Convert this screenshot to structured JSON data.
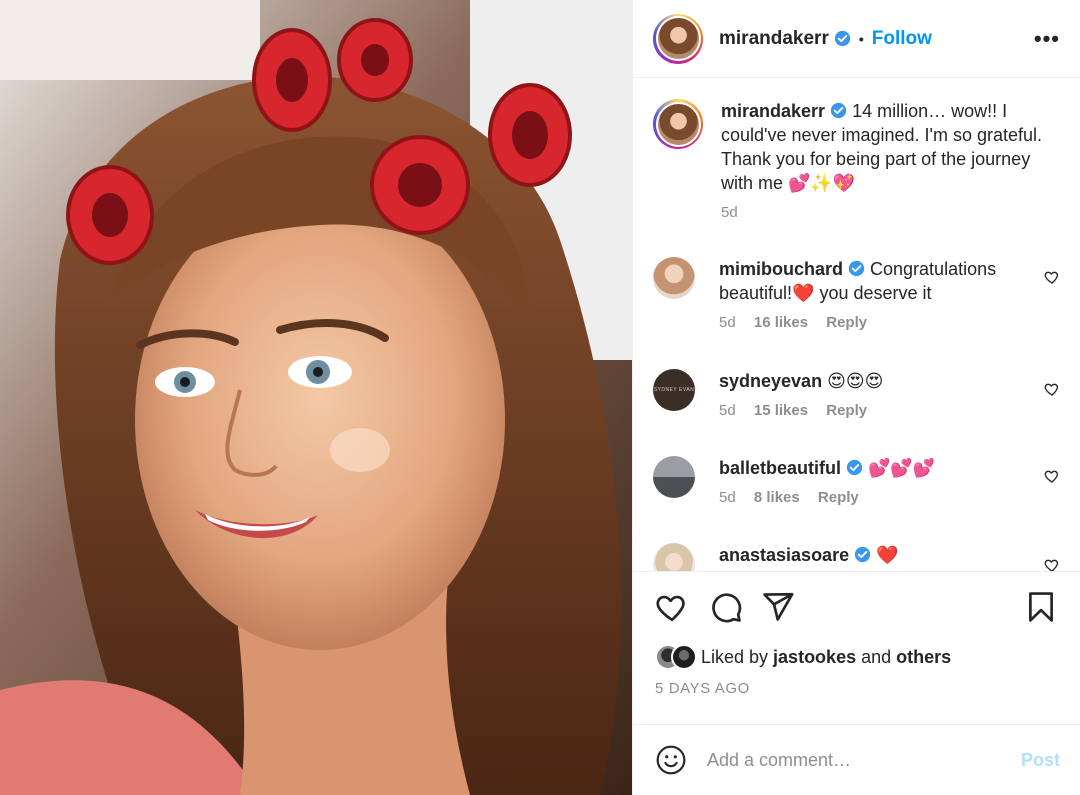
{
  "post_image": {
    "alt": "Woman with hair rollers smiling"
  },
  "author": {
    "username": "mirandakerr",
    "verified": true,
    "follow_label": "Follow",
    "separator": "•",
    "more_label": "•••"
  },
  "caption": {
    "username": "mirandakerr",
    "text": " 14 million… wow!! I could've never imagined. I'm so grateful. Thank you for being part of the journey with me 💕✨💖",
    "age": "5d"
  },
  "comments": [
    {
      "username": "mimibouchard",
      "verified": true,
      "text": " Congratulations beautiful!❤️ you deserve it",
      "age": "5d",
      "likes": "16 likes",
      "reply": "Reply",
      "avatar_color": "#c9a58c"
    },
    {
      "username": "sydneyevan",
      "verified": false,
      "text": " 😍😍😍",
      "age": "5d",
      "likes": "15 likes",
      "reply": "Reply",
      "avatar_color": "#3a2e27",
      "avatar_text": "SYDNEY EVAN"
    },
    {
      "username": "balletbeautiful",
      "verified": true,
      "text": " 💕💕💕",
      "age": "5d",
      "likes": "8 likes",
      "reply": "Reply",
      "avatar_color": "#6c6f78"
    },
    {
      "username": "anastasiasoare",
      "verified": true,
      "text": " ❤️",
      "age": "",
      "likes": "",
      "reply": "",
      "avatar_color": "#d8c9b6"
    }
  ],
  "likes_line": {
    "prefix": "Liked by ",
    "user": "jastookes",
    "middle": " and ",
    "others": "others"
  },
  "timestamp": "5 DAYS AGO",
  "composer": {
    "placeholder": "Add a comment…",
    "post_label": "Post"
  },
  "colors": {
    "link_blue": "#0095f6",
    "post_disabled": "#b2dffc",
    "secondary_text": "#8e8e8e",
    "divider": "#efefef"
  },
  "icons": [
    "heart-icon",
    "comment-icon",
    "share-icon",
    "bookmark-icon",
    "emoji-icon",
    "verified-badge-icon",
    "more-options-icon"
  ]
}
